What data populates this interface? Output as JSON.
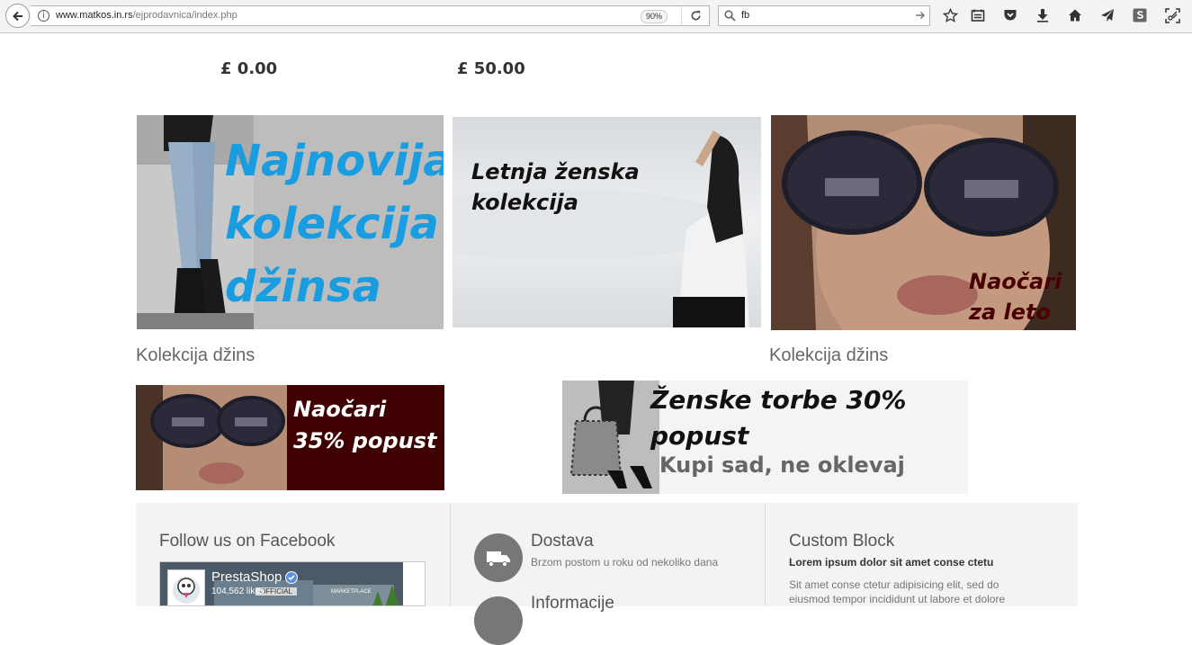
{
  "browser": {
    "url_host": "www.matkos.in.rs",
    "url_path": "/ejprodavnica/index.php",
    "zoom": "90%",
    "search_value": "fb"
  },
  "prices": [
    "£ 0.00",
    "£ 50.00"
  ],
  "banners": {
    "jeans": {
      "line1": "Najnovija",
      "line2": "kolekcija",
      "line3": "džinsa",
      "caption": "Kolekcija džins"
    },
    "summer": {
      "line1": "Letnja ženska",
      "line2": "kolekcija"
    },
    "glasses": {
      "line1": "Naočari",
      "line2": "za leto",
      "caption": "Kolekcija džins"
    },
    "glasses_sale": {
      "line1": "Naočari",
      "line2": "35% popust"
    },
    "bags": {
      "line1": "Ženske torbe 30%",
      "line2": "popust",
      "line3": "Kupi sad, ne oklevaj"
    }
  },
  "footer": {
    "facebook": {
      "title": "Follow us on Facebook",
      "page_name": "PrestaShop",
      "likes": "104,562 likes",
      "sign": "OFFICIAL",
      "sign2": "MARKETPLACE"
    },
    "shipping": {
      "title": "Dostava",
      "subtitle": "Brzom postom u roku od nekoliko dana",
      "next_title": "Informacije"
    },
    "custom": {
      "title": "Custom Block",
      "bold": "Lorem ipsum dolor sit amet conse ctetu",
      "text1": "Sit amet conse ctetur adipisicing elit, sed do",
      "text2": "eiusmod tempor incididunt ut labore et dolore"
    }
  },
  "colors": {
    "accent_blue": "#1a9ce0",
    "maroon": "#3e0000",
    "dark_red_text": "#5a0000"
  }
}
